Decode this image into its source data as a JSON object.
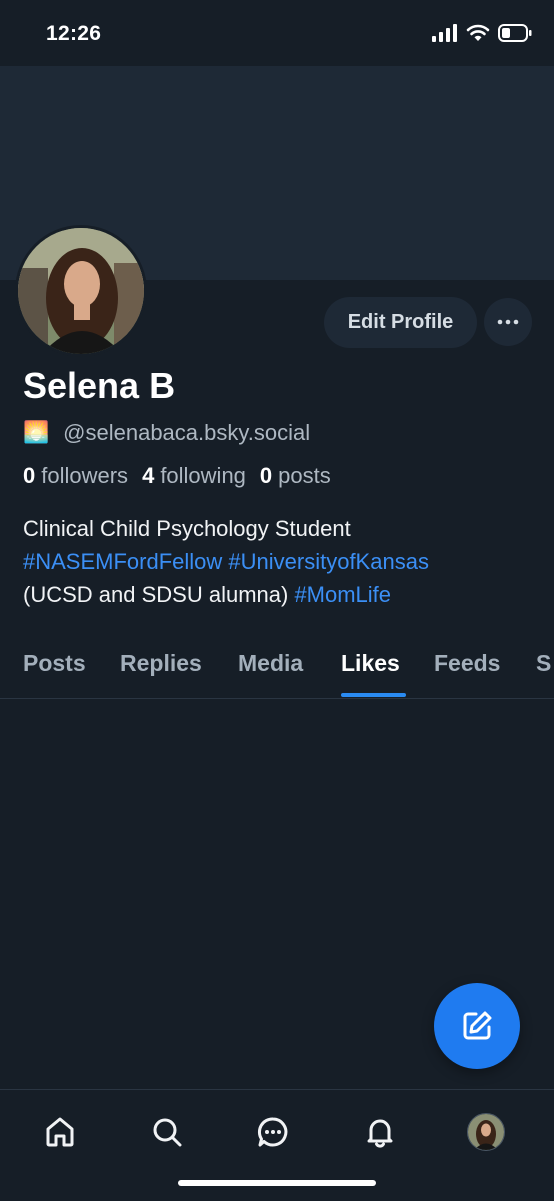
{
  "status_bar": {
    "time": "12:26",
    "icons": [
      "cellular-signal-icon",
      "wifi-icon",
      "battery-icon"
    ]
  },
  "profile": {
    "name": "Selena B",
    "handle_emoji": "🌅",
    "handle": "@selenabaca.bsky.social",
    "followers_count": "0",
    "followers_label": "followers",
    "following_count": "4",
    "following_label": "following",
    "posts_count": "0",
    "posts_label": "posts",
    "bio": {
      "line1": "Clinical Child Psychology Student",
      "tag1": "#NASEMFordFellow",
      "tag2": "#UniversityofKansas",
      "line3_text": "(UCSD and SDSU alumna)",
      "tag3": "#MomLife"
    }
  },
  "actions": {
    "edit_profile": "Edit Profile",
    "more": "more-icon"
  },
  "tabs": {
    "items": [
      "Posts",
      "Replies",
      "Media",
      "Likes",
      "Feeds",
      "S"
    ],
    "active": "Likes"
  },
  "fab": {
    "icon": "compose-icon"
  },
  "bottom_nav": {
    "items": [
      "home-icon",
      "search-icon",
      "chat-icon",
      "notifications-icon",
      "profile-avatar"
    ]
  },
  "colors": {
    "background": "#161e27",
    "banner": "#1e2936",
    "accent": "#2a8bf2",
    "hashtag": "#3b8ff5",
    "muted_text": "#aeb8c2"
  }
}
